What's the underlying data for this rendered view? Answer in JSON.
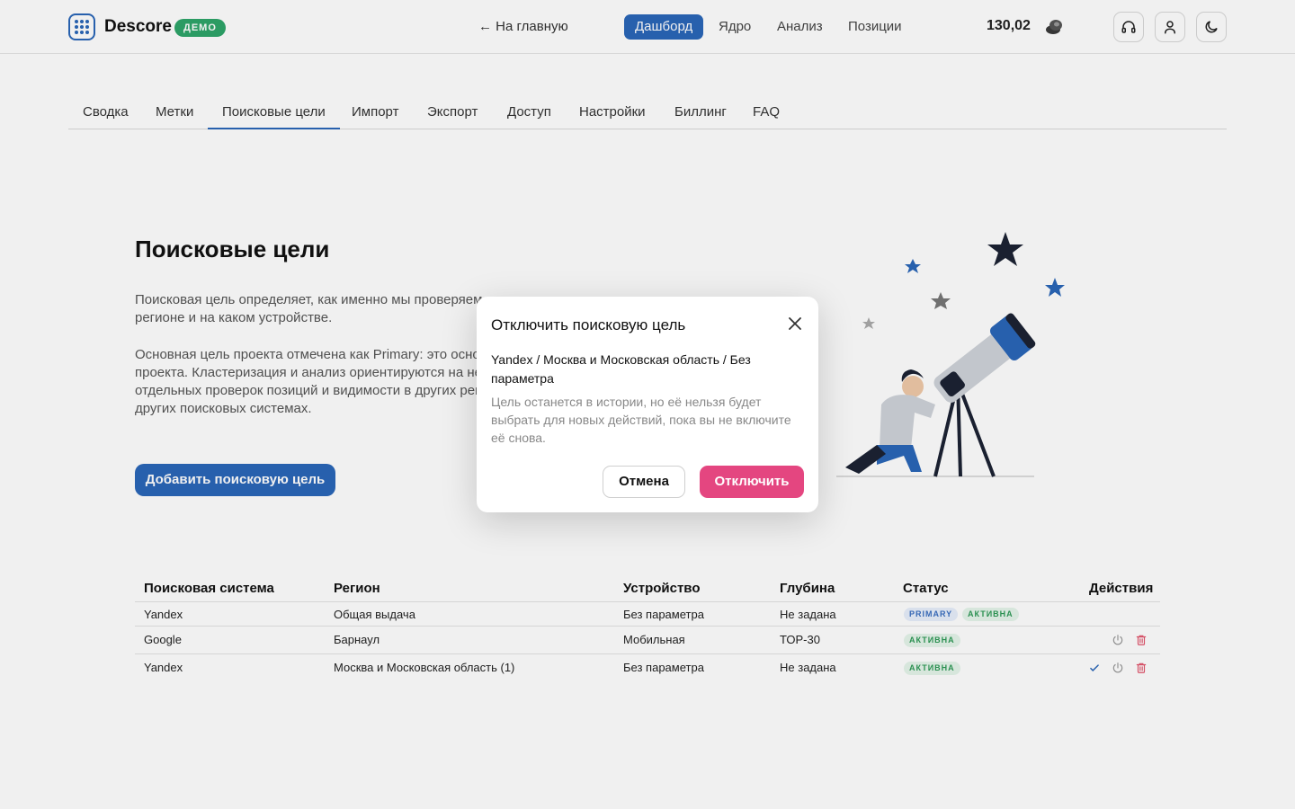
{
  "header": {
    "logo_text": "Descore",
    "demo_badge": "ДЕМО",
    "back_link": "← На главную",
    "nav": [
      {
        "label": "Дашборд",
        "active": true
      },
      {
        "label": "Ядро",
        "active": false
      },
      {
        "label": "Анализ",
        "active": false
      },
      {
        "label": "Позиции",
        "active": false
      }
    ],
    "balance": "130,02",
    "icons": [
      "coin-icon",
      "headset-icon",
      "user-icon",
      "moon-icon"
    ],
    "accent_color": "#2a66b8"
  },
  "tabs": [
    {
      "label": "Сводка",
      "active": false
    },
    {
      "label": "Метки",
      "active": false
    },
    {
      "label": "Поисковые цели",
      "active": true
    },
    {
      "label": "Импорт",
      "active": false
    },
    {
      "label": "Экспорт",
      "active": false
    },
    {
      "label": "Доступ",
      "active": false
    },
    {
      "label": "Настройки",
      "active": false
    },
    {
      "label": "Биллинг",
      "active": false
    },
    {
      "label": "FAQ",
      "active": false
    }
  ],
  "main": {
    "title": "Поисковые цели",
    "desc_lines_1": [
      "Поисковая цель определяет, как именно мы проверяем",
      "регионе и на каком устройстве."
    ],
    "desc_lines_2": [
      "Основная цель проекта отмечена как Primary: это основ",
      "проекта. Кластеризация и анализ ориентируются на нее",
      "отдельных проверок позиций и видимости в других рег",
      "других поисковых системах."
    ],
    "add_button": "Добавить поисковую цель"
  },
  "table": {
    "headers": [
      "Поисковая система",
      "Регион",
      "Устройство",
      "Глубина",
      "Статус",
      "Действия"
    ],
    "rows": [
      {
        "engine": "Yandex",
        "region": "Общая выдача",
        "device": "Без параметра",
        "depth": "Не задана",
        "tags": [
          "PRIMARY",
          "АКТИВНА"
        ],
        "actions": []
      },
      {
        "engine": "Google",
        "region": "Барнаул",
        "device": "Мобильная",
        "depth": "ТОР-30",
        "tags": [
          "АКТИВНА"
        ],
        "actions": [
          "power-icon",
          "trash-icon"
        ]
      },
      {
        "engine": "Yandex",
        "region": "Москва и Московская область (1)",
        "device": "Без параметра",
        "depth": "Не задана",
        "tags": [
          "АКТИВНА"
        ],
        "actions": [
          "check-icon",
          "power-icon",
          "trash-icon"
        ]
      }
    ]
  },
  "modal": {
    "title": "Отключить поисковую цель",
    "subject": "Yandex / Москва и Московская область / Без параметра",
    "note": "Цель останется в истории, но её нельзя будет выбрать для новых действий, пока вы не включите её снова.",
    "cancel": "Отмена",
    "confirm": "Отключить",
    "confirm_color": "#e44680"
  }
}
